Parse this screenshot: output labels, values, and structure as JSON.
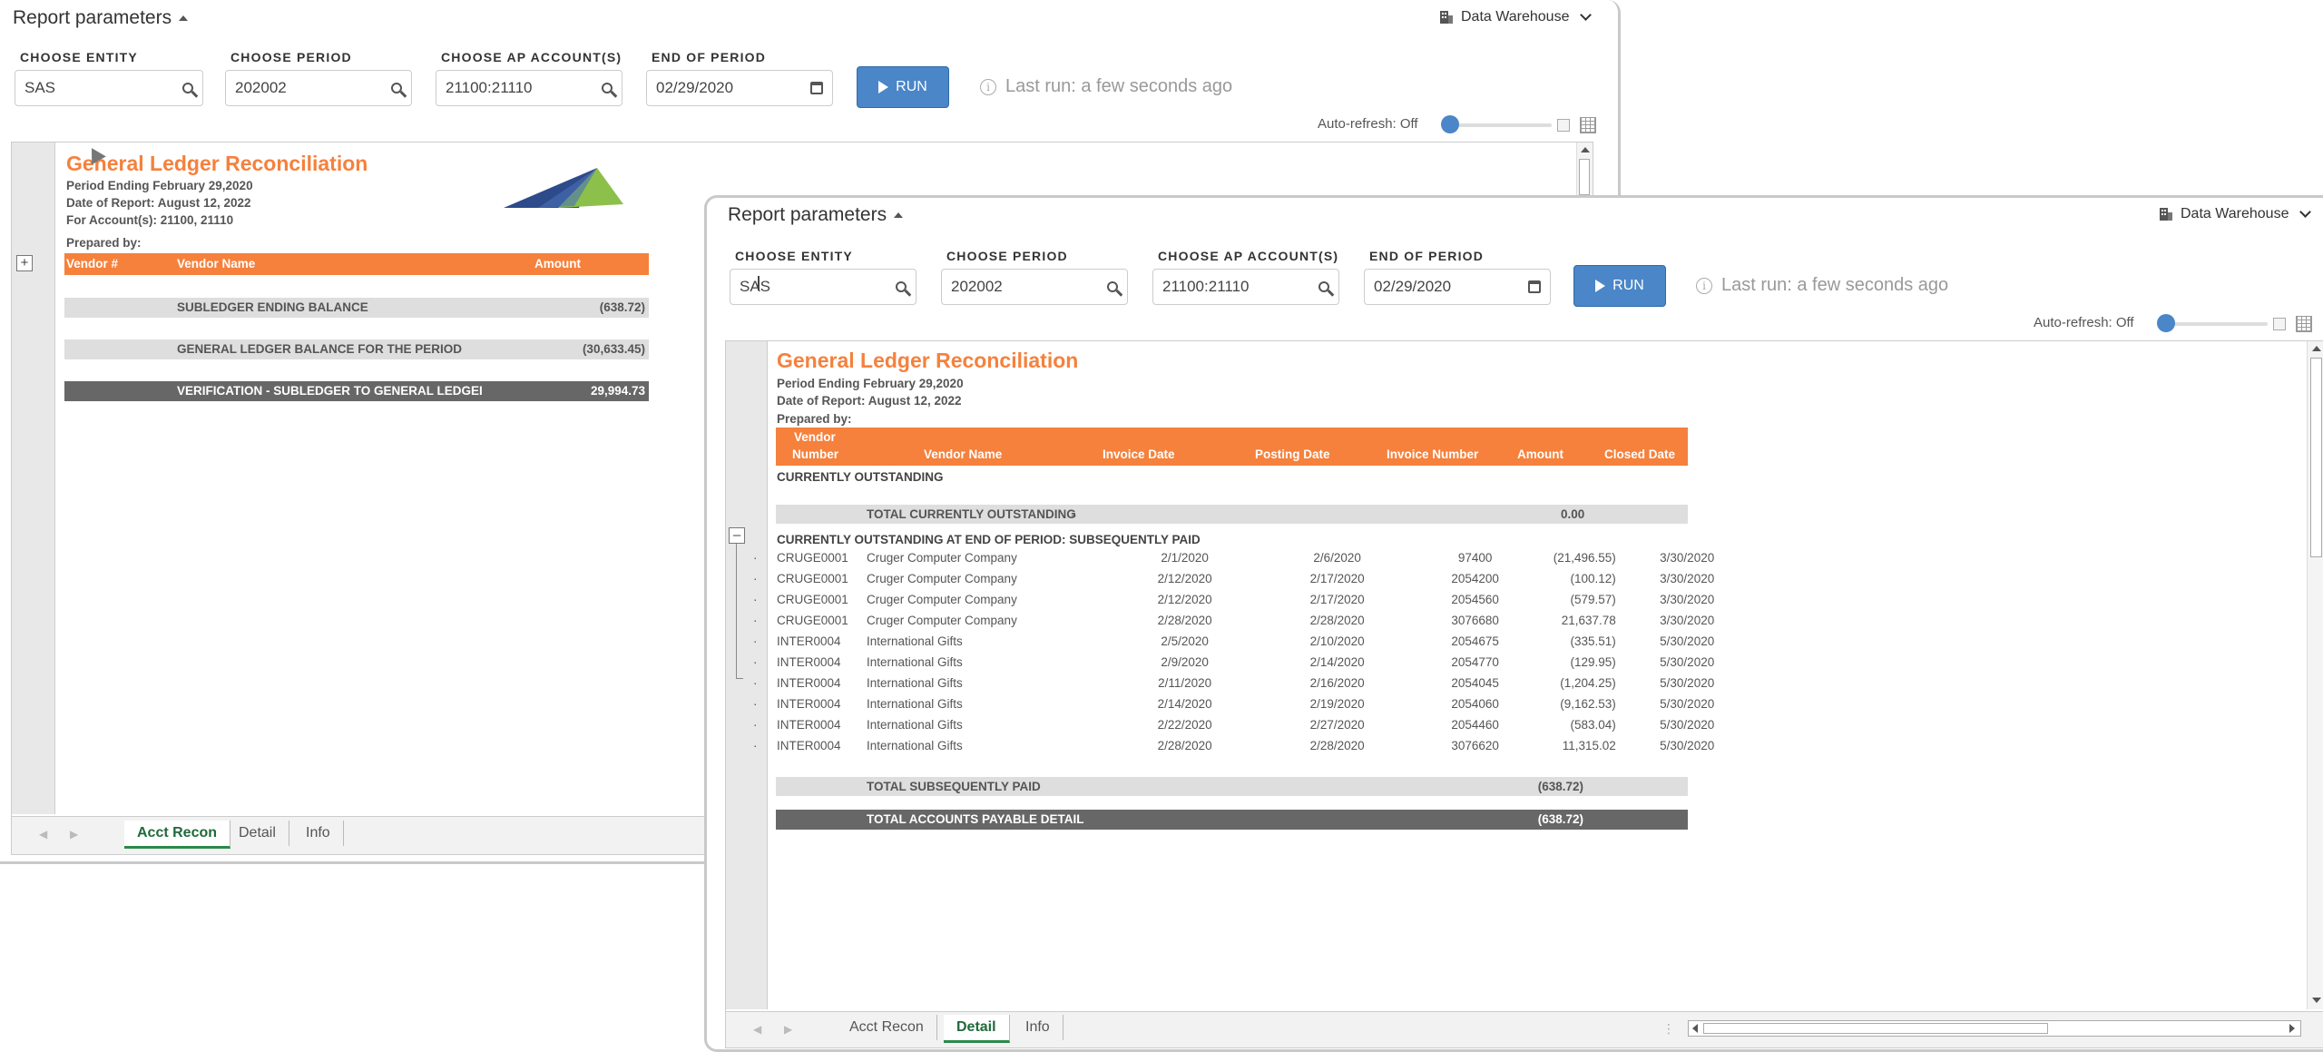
{
  "window1": {
    "header": {
      "title": "Report parameters",
      "dw_label": "Data Warehouse"
    },
    "params": {
      "entity": {
        "label": "CHOOSE ENTITY",
        "value": "SAS"
      },
      "period": {
        "label": "CHOOSE PERIOD",
        "value": "202002"
      },
      "account": {
        "label": "CHOOSE AP ACCOUNT(S)",
        "value": "21100:21110"
      },
      "end": {
        "label": "END OF PERIOD",
        "value": "02/29/2020"
      },
      "run_label": "RUN",
      "last_run": "Last run: a few seconds ago",
      "auto_refresh": "Auto-refresh: Off"
    },
    "report": {
      "title": "General Ledger Reconciliation",
      "meta": [
        "Period Ending February 29,2020",
        "Date of Report: August 12, 2022",
        "For Account(s): 21100, 21110",
        "Prepared by:"
      ],
      "columns": [
        "Vendor #",
        "Vendor Name",
        "Amount"
      ],
      "rows": [
        {
          "label": "SUBLEDGER ENDING BALANCE",
          "amount": "(638.72)"
        },
        {
          "label": "GENERAL LEDGER BALANCE FOR THE PERIOD",
          "amount": "(30,633.45)"
        },
        {
          "label": "VERIFICATION - SUBLEDGER TO GENERAL LEDGEI",
          "amount": "29,994.73"
        }
      ]
    },
    "tabs": [
      "Acct Recon",
      "Detail",
      "Info"
    ],
    "active_tab": "Acct Recon"
  },
  "window2": {
    "header": {
      "title": "Report parameters",
      "dw_label": "Data Warehouse"
    },
    "params": {
      "entity": {
        "label": "CHOOSE ENTITY",
        "value": "SAS"
      },
      "period": {
        "label": "CHOOSE PERIOD",
        "value": "202002"
      },
      "account": {
        "label": "CHOOSE AP ACCOUNT(S)",
        "value": "21100:21110"
      },
      "end": {
        "label": "END OF PERIOD",
        "value": "02/29/2020"
      },
      "run_label": "RUN",
      "last_run": "Last run: a few seconds ago",
      "auto_refresh": "Auto-refresh: Off"
    },
    "report": {
      "title": "General Ledger Reconciliation",
      "meta": [
        "Period Ending February 29,2020",
        "Date of Report: August 12, 2022",
        "Prepared by:"
      ],
      "columns": [
        "Vendor",
        "Number",
        "Vendor Name",
        "Invoice Date",
        "Posting Date",
        "Invoice Number",
        "Amount",
        "Closed Date"
      ],
      "section1": "CURRENTLY OUTSTANDING",
      "total1": {
        "label": "TOTAL CURRENTLY OUTSTANDINǤ",
        "amount": "0.00"
      },
      "section2": "CURRENTLY OUTSTANDING AT END OF PERIOD: SUBSEQUENTLY PAID",
      "rows": [
        [
          "CRUGE0001",
          "Cruger Computer Company",
          "2/1/2020",
          "2/6/2020",
          "97400",
          "(21,496.55)",
          "3/30/2020"
        ],
        [
          "CRUGE0001",
          "Cruger Computer Company",
          "2/12/2020",
          "2/17/2020",
          "2054200",
          "(100.12)",
          "3/30/2020"
        ],
        [
          "CRUGE0001",
          "Cruger Computer Company",
          "2/12/2020",
          "2/17/2020",
          "2054560",
          "(579.57)",
          "3/30/2020"
        ],
        [
          "CRUGE0001",
          "Cruger Computer Company",
          "2/28/2020",
          "2/28/2020",
          "3076680",
          "21,637.78",
          "3/30/2020"
        ],
        [
          "INTER0004",
          "International Gifts",
          "2/5/2020",
          "2/10/2020",
          "2054675",
          "(335.51)",
          "5/30/2020"
        ],
        [
          "INTER0004",
          "International Gifts",
          "2/9/2020",
          "2/14/2020",
          "2054770",
          "(129.95)",
          "5/30/2020"
        ],
        [
          "INTER0004",
          "International Gifts",
          "2/11/2020",
          "2/16/2020",
          "2054045",
          "(1,204.25)",
          "5/30/2020"
        ],
        [
          "INTER0004",
          "International Gifts",
          "2/14/2020",
          "2/19/2020",
          "2054060",
          "(9,162.53)",
          "5/30/2020"
        ],
        [
          "INTER0004",
          "International Gifts",
          "2/22/2020",
          "2/27/2020",
          "2054460",
          "(583.04)",
          "5/30/2020"
        ],
        [
          "INTER0004",
          "International Gifts",
          "2/28/2020",
          "2/28/2020",
          "3076620",
          "11,315.02",
          "5/30/2020"
        ]
      ],
      "total2": {
        "label": "TOTAL SUBSEQUENTLY PAID",
        "amount": "(638.72)"
      },
      "total3": {
        "label": "TOTAL ACCOUNTS PAYABLE DETAIL",
        "amount": "(638.72)"
      }
    },
    "tabs": [
      "Acct Recon",
      "Detail",
      "Info"
    ],
    "active_tab": "Detail"
  },
  "colors": {
    "accent": "#f5813c",
    "run_button": "#4a86c8",
    "active_tab": "#2a8a48",
    "total_dark": "#676767"
  },
  "icons": [
    "chevron-up-icon",
    "building-icon",
    "chevron-down-icon",
    "search-icon",
    "calendar-icon",
    "play-icon",
    "info-icon",
    "expand-icon",
    "collapse-icon",
    "logo-mountain",
    "grid-icon"
  ]
}
